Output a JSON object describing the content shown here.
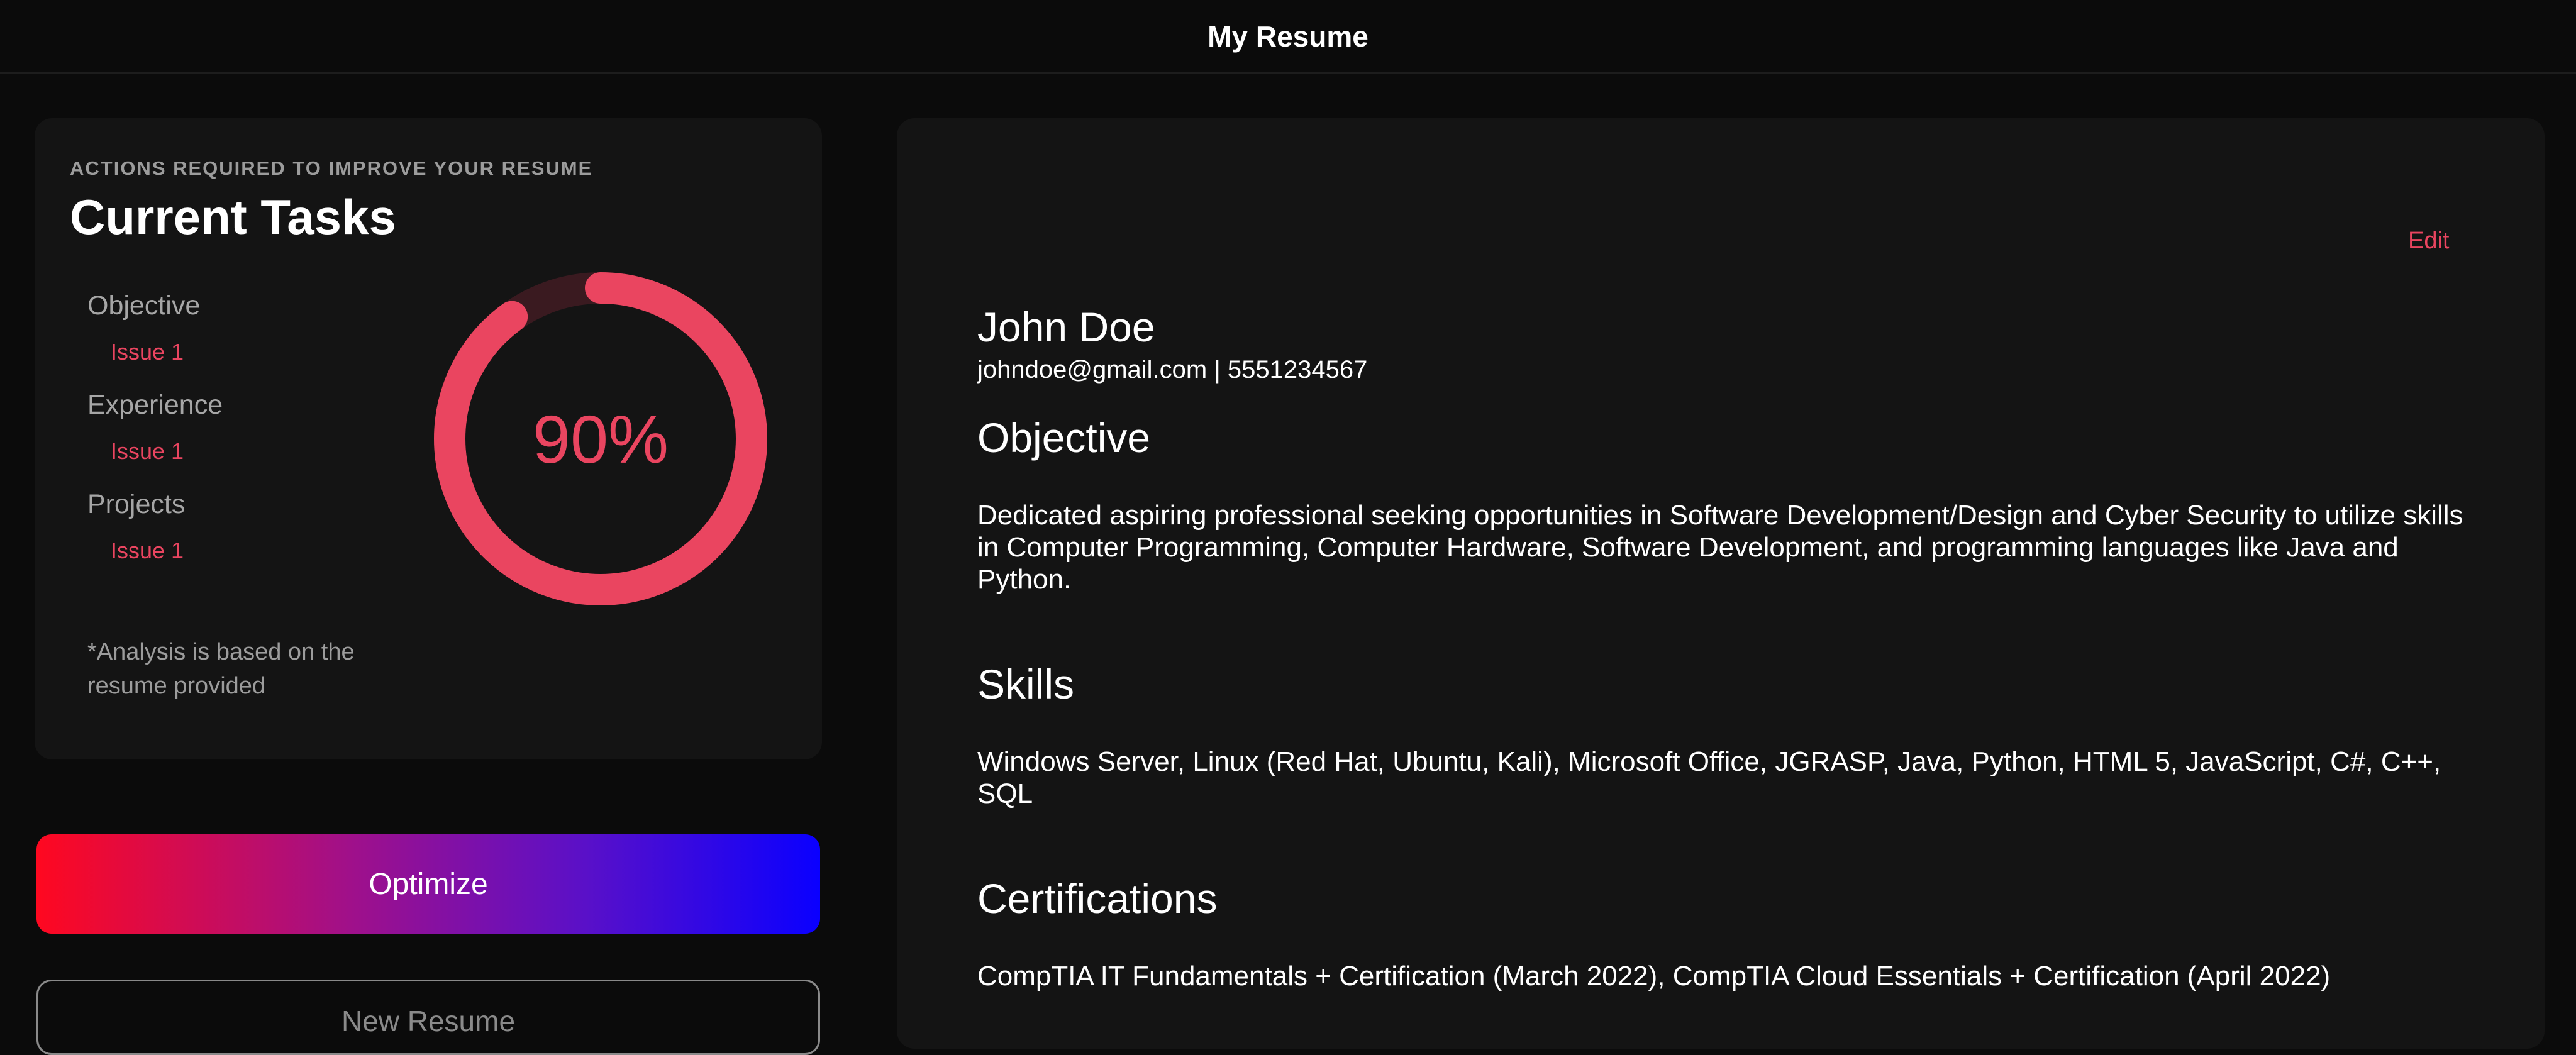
{
  "header": {
    "title": "My Resume"
  },
  "tasks_card": {
    "kicker": "ACTIONS REQUIRED TO IMPROVE YOUR RESUME",
    "title": "Current Tasks",
    "groups": [
      {
        "name": "Objective",
        "issue": "Issue 1"
      },
      {
        "name": "Experience",
        "issue": "Issue 1"
      },
      {
        "name": "Projects",
        "issue": "Issue 1"
      }
    ],
    "note": "*Analysis is based on the resume provided",
    "score_label": "90%",
    "score_fraction": 0.9
  },
  "actions": {
    "optimize_label": "Optimize",
    "new_resume_label": "New Resume"
  },
  "resume": {
    "edit_label": "Edit",
    "name": "John Doe",
    "contact": "johndoe@gmail.com | 5551234567",
    "sections": [
      {
        "heading": "Objective",
        "body": "Dedicated aspiring professional seeking opportunities in Software Development/Design and Cyber Security to utilize skills in Computer Programming, Computer Hardware, Software Development, and programming languages like Java and Python."
      },
      {
        "heading": "Skills",
        "body": "Windows Server, Linux (Red Hat, Ubuntu, Kali), Microsoft Office, JGRASP, Java, Python, HTML 5, JavaScript, C#, C++, SQL"
      },
      {
        "heading": "Certifications",
        "body": "CompTIA IT Fundamentals + Certification (March 2022), CompTIA Cloud Essentials + Certification (April 2022)"
      }
    ]
  },
  "colors": {
    "background": "#0b0b0b",
    "card": "#141414",
    "accent": "#ea4560",
    "ring_track": "#3a1a20",
    "gradient_start": "#ff0820",
    "gradient_end": "#0a00ff"
  }
}
